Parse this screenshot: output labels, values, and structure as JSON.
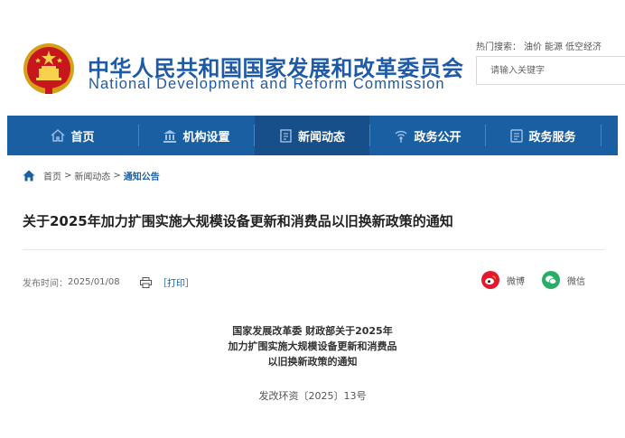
{
  "header": {
    "title_cn": "中华人民共和国国家发展和改革委员会",
    "title_en": "National Development and Reform Commission",
    "hot_search_label": "热门搜索：",
    "hot_search_items": [
      "油价",
      "能源",
      "低空经济"
    ],
    "search_placeholder": "请输入关键字"
  },
  "nav": {
    "items": [
      {
        "label": "首页",
        "icon": "home-icon"
      },
      {
        "label": "机构设置",
        "icon": "building-icon"
      },
      {
        "label": "新闻动态",
        "icon": "news-icon",
        "active": true
      },
      {
        "label": "政务公开",
        "icon": "signal-icon"
      },
      {
        "label": "政务服务",
        "icon": "service-icon"
      }
    ]
  },
  "breadcrumb": {
    "items": [
      "首页",
      "新闻动态",
      "通知公告"
    ],
    "separator": ">"
  },
  "article": {
    "title": "关于2025年加力扩围实施大规模设备更新和消费品以旧换新政策的通知",
    "publish_label": "发布时间：",
    "publish_date": "2025/01/08",
    "print_label": "［打印］",
    "share": [
      {
        "label": "微博",
        "icon": "weibo-icon",
        "color": "#e6162d"
      },
      {
        "label": "微信",
        "icon": "wechat-icon",
        "color": "#2aae67"
      }
    ],
    "doc_heading_lines": [
      "国家发展改革委  财政部关于2025年",
      "加力扩围实施大规模设备更新和消费品",
      "以旧换新政策的通知"
    ],
    "doc_number": "发改环资〔2025〕13号"
  },
  "colors": {
    "brand_blue": "#1b5fa3",
    "nav_active": "#174f8a",
    "title_blue": "#1e5aa8"
  }
}
